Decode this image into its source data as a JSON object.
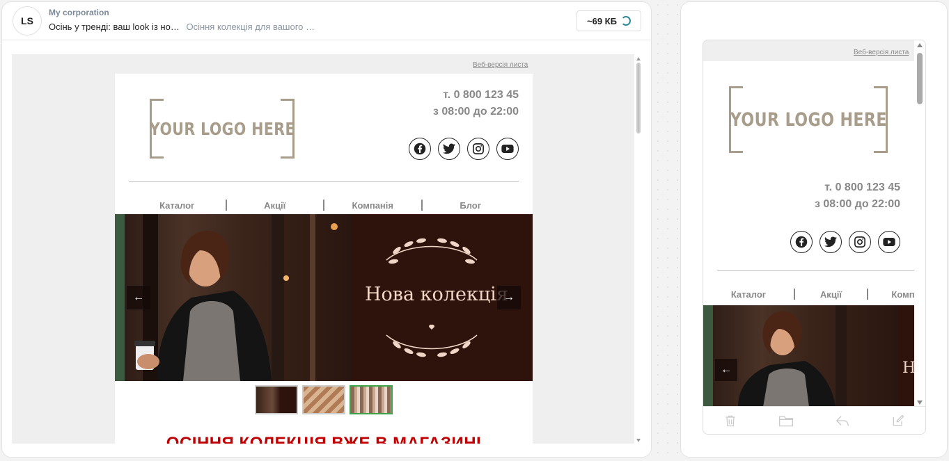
{
  "header": {
    "avatar_initials": "LS",
    "sender": "My corporation",
    "subject": "Осінь у тренді: ваш look із но…",
    "preheader": "Осіння колекція для вашого …",
    "size_label": "~69 КБ"
  },
  "email": {
    "web_version_link": "Веб-версія листа",
    "logo_text": "YOUR LOGO HERE",
    "phone": "т. 0 800 123 45",
    "hours": "з 08:00 до 22:00",
    "socials": [
      "facebook-icon",
      "twitter-icon",
      "instagram-icon",
      "youtube-icon"
    ],
    "menu": [
      "Каталог",
      "Акції",
      "Компанія",
      "Блог"
    ],
    "hero_title": "Нова колекція",
    "promo_heading": "ОСІННЯ КОЛЕКЦІЯ ВЖЕ В МАГАЗИНІ"
  },
  "mobile": {
    "web_version_link": "Веб-версія листа",
    "logo_text": "YOUR LOGO HERE",
    "phone": "т. 0 800 123 45",
    "hours": "з 08:00 до 22:00",
    "menu": [
      "Каталог",
      "Акції",
      "Комп"
    ],
    "hero_title_fragment": "Н",
    "toolbar": [
      "trash-icon",
      "folder-icon",
      "reply-icon",
      "compose-icon"
    ]
  },
  "colors": {
    "accent_red": "#c00000",
    "logo_taupe": "#a89d8a",
    "hero_dark": "#2e130c",
    "active_thumb": "#3ba34a"
  }
}
